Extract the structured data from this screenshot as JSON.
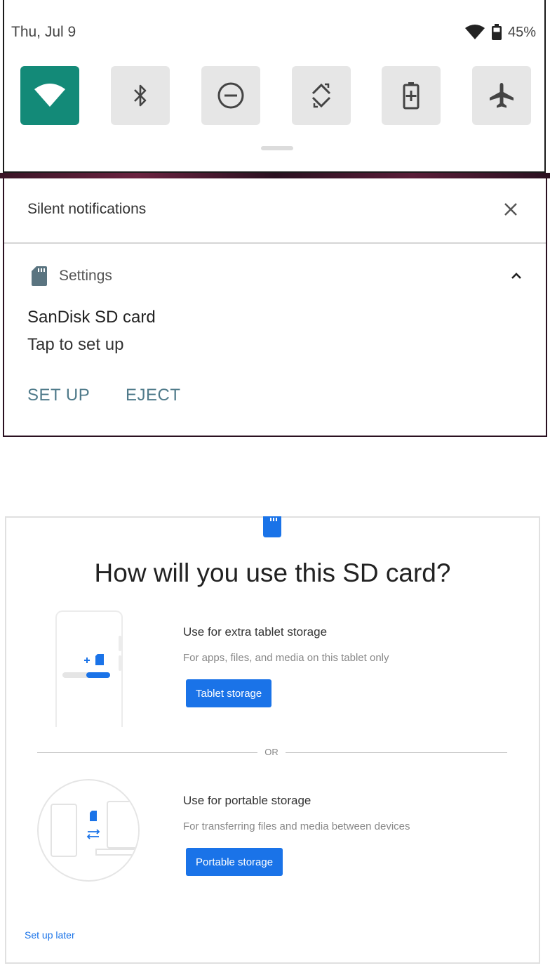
{
  "quick_settings": {
    "date": "Thu, Jul 9",
    "battery_percent": "45%",
    "tiles": [
      {
        "name": "wifi-icon",
        "active": true
      },
      {
        "name": "bluetooth-icon",
        "active": false
      },
      {
        "name": "do-not-disturb-icon",
        "active": false
      },
      {
        "name": "auto-rotate-icon",
        "active": false
      },
      {
        "name": "battery-saver-icon",
        "active": false
      },
      {
        "name": "airplane-mode-icon",
        "active": false
      }
    ]
  },
  "notifications": {
    "section_title": "Silent notifications",
    "app_name": "Settings",
    "title": "SanDisk SD card",
    "text": "Tap to set up",
    "actions": {
      "setup": "SET UP",
      "eject": "EJECT"
    }
  },
  "dialog": {
    "title": "How will you use this SD card?",
    "option1": {
      "title": "Use for extra tablet storage",
      "description": "For apps, files, and media on this tablet only",
      "button": "Tablet storage"
    },
    "separator": "OR",
    "option2": {
      "title": "Use for portable storage",
      "description": "For transferring files and media between devices",
      "button": "Portable storage"
    },
    "later_link": "Set up later"
  },
  "colors": {
    "accent": "#1a73e8",
    "wifi_tile_on": "#138a78",
    "notification_action": "#4f7a8a"
  }
}
